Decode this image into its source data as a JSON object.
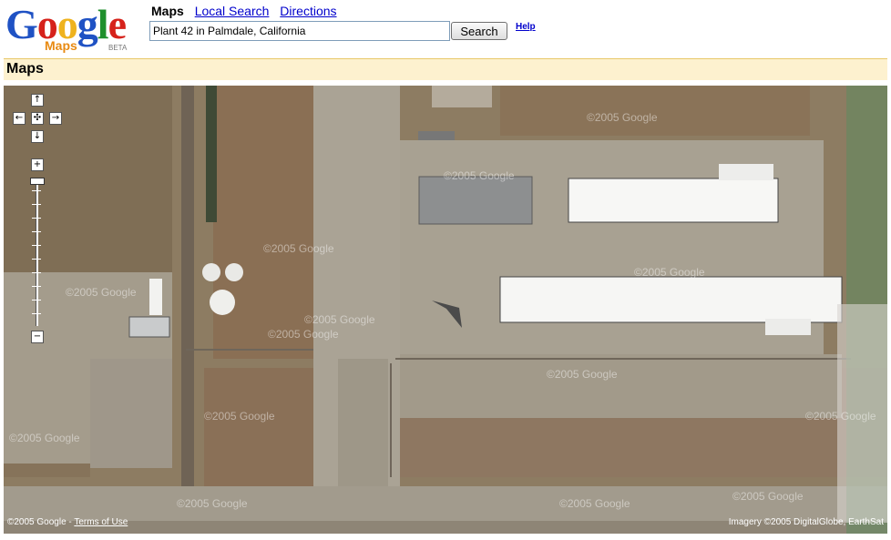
{
  "logo": {
    "letters": [
      "G",
      "o",
      "o",
      "g",
      "l",
      "e"
    ],
    "product": "Maps",
    "badge": "BETA"
  },
  "nav": {
    "current": "Maps",
    "local_search": "Local Search",
    "directions": "Directions"
  },
  "search": {
    "value": "Plant 42 in Palmdale, California",
    "button_label": "Search",
    "help_label": "Help"
  },
  "title_bar": {
    "label": "Maps"
  },
  "map_controls": {
    "pan_up": "↑",
    "pan_left": "←",
    "pan_center": "✣",
    "pan_right": "→",
    "pan_down": "↓",
    "zoom_in": "+",
    "zoom_out": "−"
  },
  "map": {
    "view": "satellite",
    "watermark": "©2005 Google",
    "copyright": "©2005 Google - ",
    "terms_link": "Terms of Use",
    "imagery_credit": "Imagery ©2005 DigitalGlobe, EarthSat"
  },
  "colors": {
    "title_bar_bg": "#fdf1cf",
    "link": "#0000cc",
    "terrain": "#8f7e64",
    "runway": "#a7a091"
  }
}
